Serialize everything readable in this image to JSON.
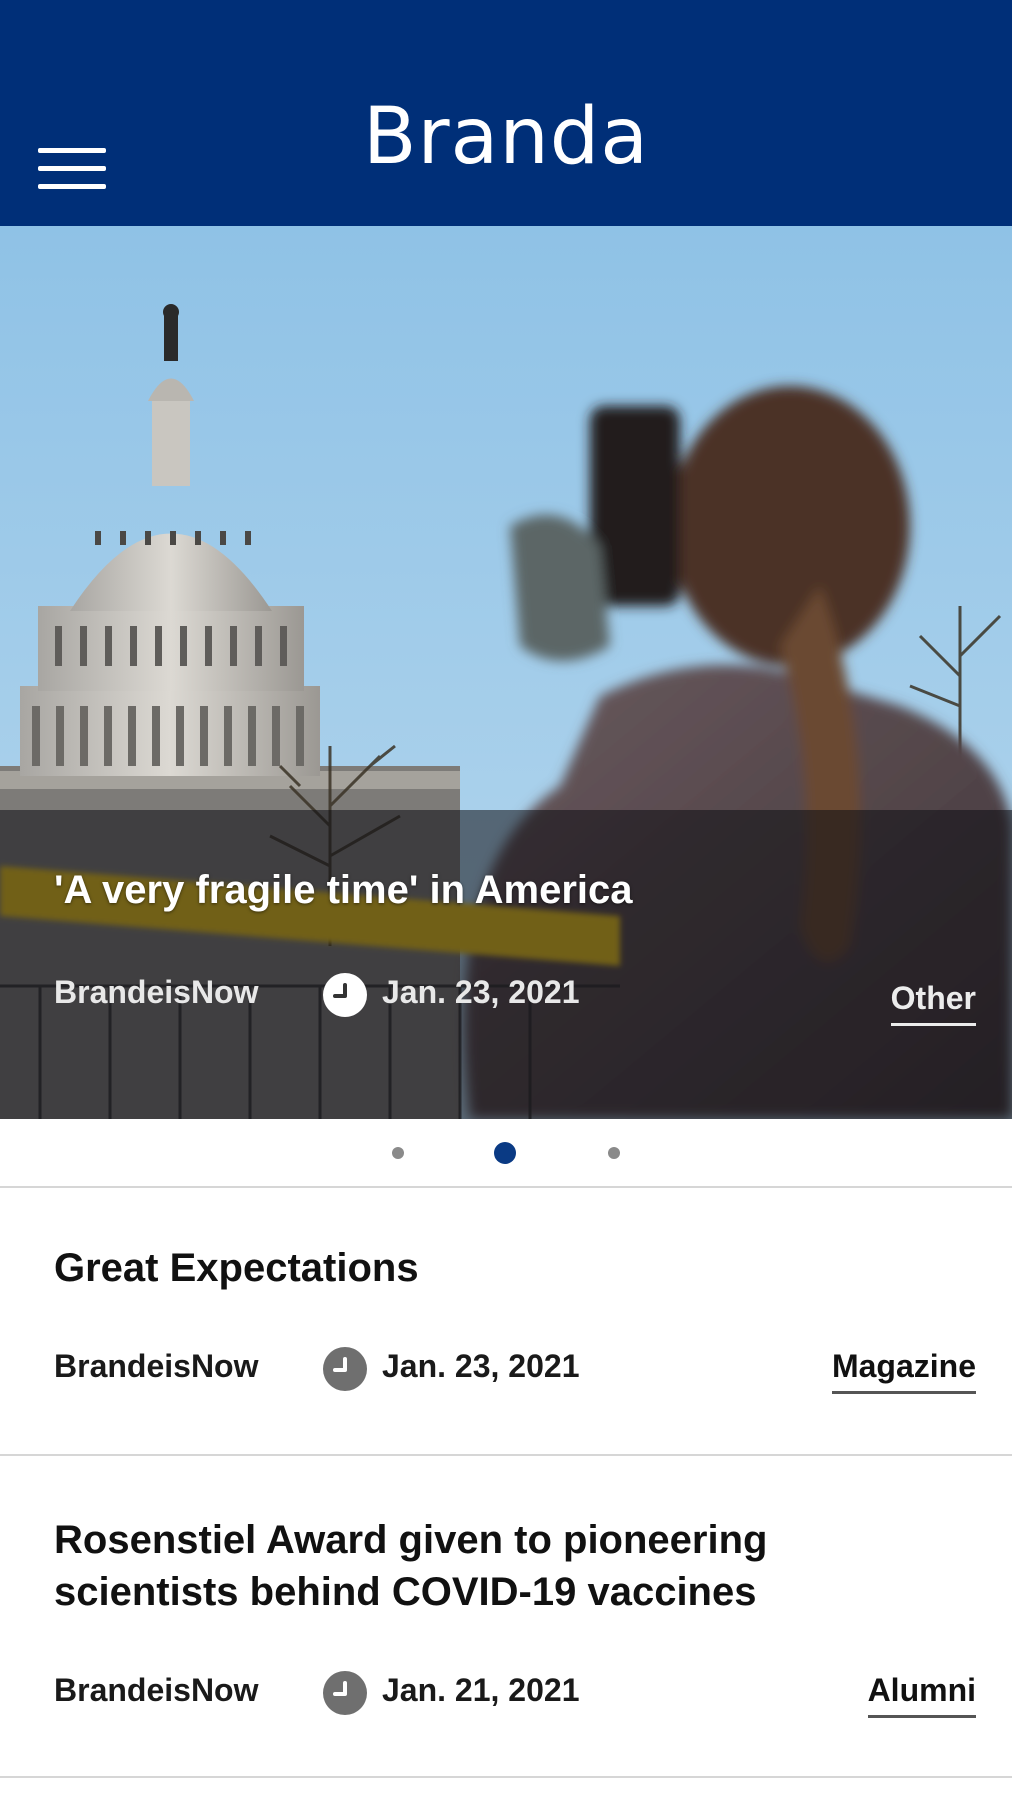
{
  "header": {
    "title": "Branda",
    "menu_icon": "hamburger-menu-icon",
    "background_color": "#002f78"
  },
  "featured": {
    "title": "'A very fragile time' in America",
    "source": "BrandeisNow",
    "date": "Jan. 23, 2021",
    "category": "Other",
    "clock_icon": "clock-icon"
  },
  "carousel": {
    "total": 3,
    "active_index": 2,
    "active_color": "#0a3a84"
  },
  "articles": [
    {
      "title": "Great Expectations",
      "source": "BrandeisNow",
      "date": "Jan. 23, 2021",
      "category": "Magazine"
    },
    {
      "title": "Rosenstiel Award given to pioneering scientists behind COVID-19 vaccines",
      "source": "BrandeisNow",
      "date": "Jan. 21, 2021",
      "category": "Alumni"
    }
  ]
}
